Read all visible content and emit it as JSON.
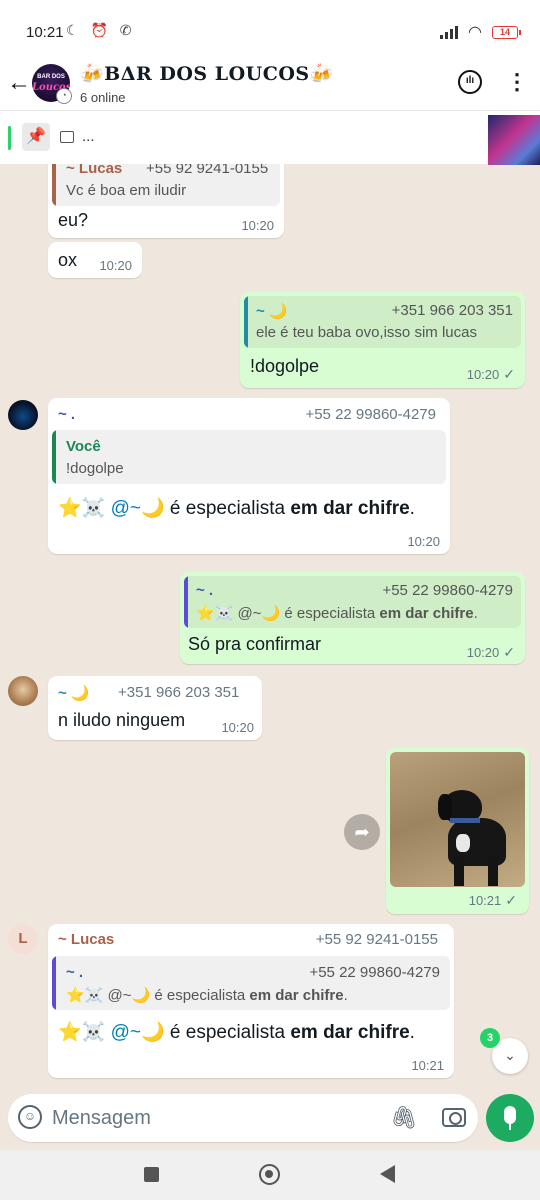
{
  "status_bar": {
    "time": "10:21",
    "left_icons": "☾ ⏰ ✆",
    "battery": "14"
  },
  "header": {
    "avatar_text_small": "BAR DOS",
    "avatar_text_large": "Loucos",
    "title": "🍻BΔR DOS LOUCOS🍻",
    "status": "6 online"
  },
  "pinned": {
    "text": "..."
  },
  "messages": {
    "m1": {
      "quote_name": "~ Lucas",
      "quote_phone": "+55 92 9241-0155",
      "quote_text": "Vc é boa em iludir",
      "text": "eu?",
      "time": "10:20"
    },
    "m2": {
      "text": "ox",
      "time": "10:20"
    },
    "m3": {
      "quote_name": "~ 🌙",
      "quote_phone": "+351 966 203 351",
      "quote_text": "ele é teu baba ovo,isso sim lucas",
      "text": "!dogolpe",
      "time": "10:20",
      "tick": "✓"
    },
    "m4": {
      "sender": "~ .",
      "phone": "+55 22 99860-4279",
      "quote_name": "Você",
      "quote_text": "!dogolpe",
      "text_prefix": "⭐☠️ ",
      "mention": "@~🌙",
      "text_mid": " é especialista ",
      "text_bold": "em dar chifre",
      "text_suffix": ".",
      "time": "10:20"
    },
    "m5": {
      "quote_name": "~ .",
      "quote_phone": "+55 22 99860-4279",
      "quote_prefix": "⭐☠️ @~🌙 é especialista ",
      "quote_bold": "em dar chifre",
      "quote_suffix": ".",
      "text": "Só pra confirmar",
      "time": "10:20",
      "tick": "✓"
    },
    "m6": {
      "sender": "~ 🌙",
      "phone": "+351 966 203 351",
      "text": "n iludo ninguem",
      "time": "10:20"
    },
    "m7": {
      "time": "10:21",
      "tick": "✓"
    },
    "m8": {
      "avatar_letter": "L",
      "sender": "~ Lucas",
      "phone": "+55 92 9241-0155",
      "quote_name": "~ .",
      "quote_phone": "+55 22 99860-4279",
      "quote_prefix": "⭐☠️ @~🌙 é especialista ",
      "quote_bold": "em dar chifre",
      "quote_suffix": ".",
      "text_prefix": "⭐☠️ ",
      "mention": "@~🌙",
      "text_mid": " é especialista ",
      "text_bold": "em dar chifre",
      "text_suffix": ".",
      "time": "10:21"
    }
  },
  "unread_count": "3",
  "composer": {
    "placeholder": "Mensagem"
  },
  "colors": {
    "accent": "#1daa61",
    "outgoing_bubble": "#d9fdd3",
    "incoming_bubble": "#ffffff",
    "chat_background": "#efe7dd",
    "lucas_name": "#a7634a",
    "dot_name": "#3b5aa8",
    "moon_name": "#1f8ea3",
    "you_quote": "#1b8755",
    "dot_quote_bar": "#5b4bd6"
  }
}
